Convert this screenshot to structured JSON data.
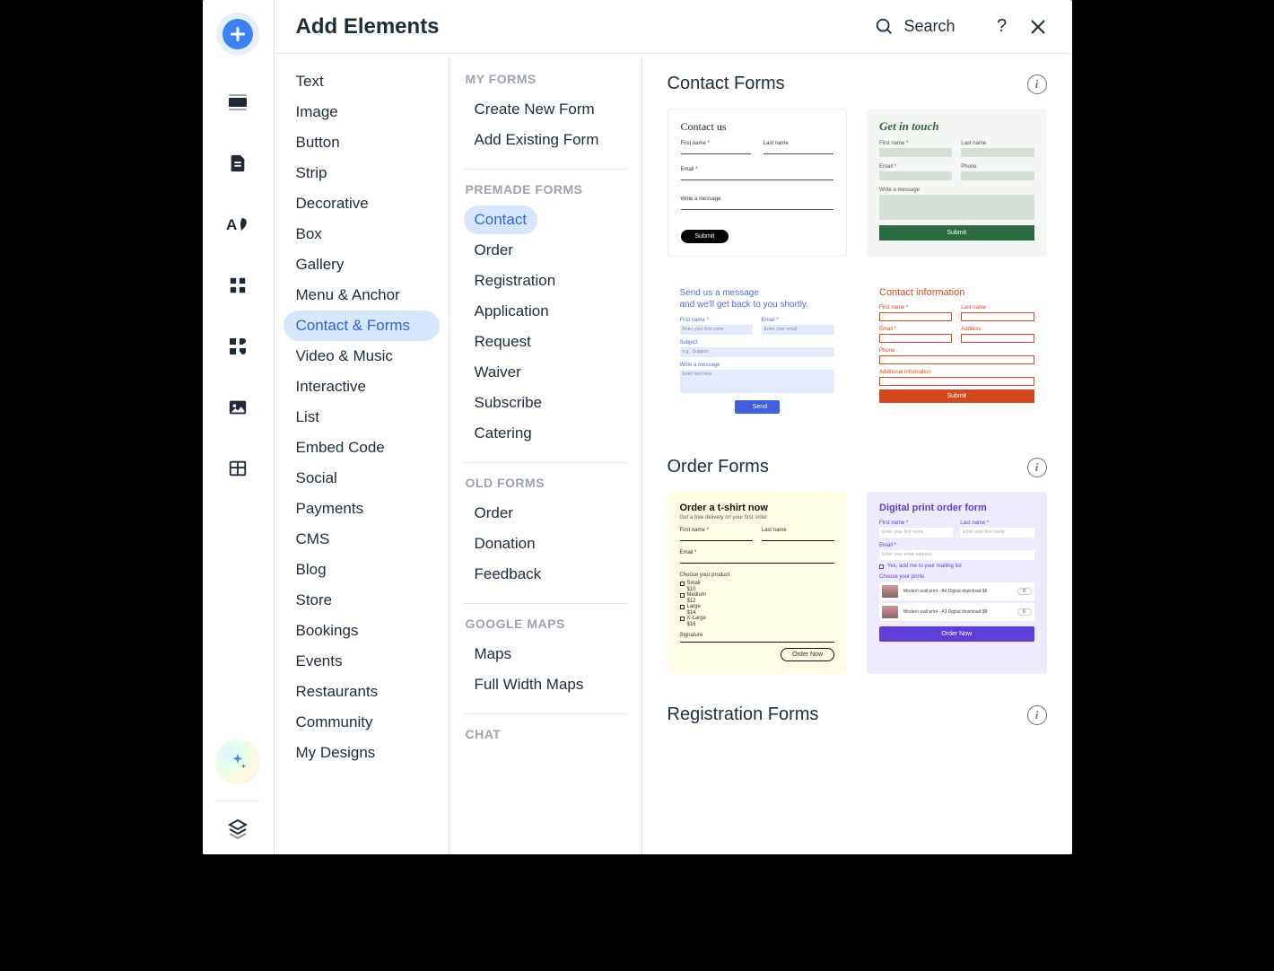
{
  "header": {
    "title": "Add Elements",
    "search_label": "Search"
  },
  "categories": [
    "Text",
    "Image",
    "Button",
    "Strip",
    "Decorative",
    "Box",
    "Gallery",
    "Menu & Anchor",
    "Contact & Forms",
    "Video & Music",
    "Interactive",
    "List",
    "Embed Code",
    "Social",
    "Payments",
    "CMS",
    "Blog",
    "Store",
    "Bookings",
    "Events",
    "Restaurants",
    "Community",
    "My Designs"
  ],
  "active_category": "Contact & Forms",
  "groups": [
    {
      "label": "MY FORMS",
      "items": [
        "Create New Form",
        "Add Existing Form"
      ]
    },
    {
      "label": "PREMADE FORMS",
      "items": [
        "Contact",
        "Order",
        "Registration",
        "Application",
        "Request",
        "Waiver",
        "Subscribe",
        "Catering"
      ]
    },
    {
      "label": "OLD FORMS",
      "items": [
        "Order",
        "Donation",
        "Feedback"
      ]
    },
    {
      "label": "GOOGLE MAPS",
      "items": [
        "Maps",
        "Full Width Maps"
      ]
    },
    {
      "label": "CHAT",
      "items": []
    }
  ],
  "active_sub": "Contact",
  "sections": [
    {
      "title": "Contact Forms"
    },
    {
      "title": "Order Forms"
    },
    {
      "title": "Registration Forms"
    }
  ],
  "previews": {
    "pv1": {
      "title": "Contact us",
      "first": "First name *",
      "last": "Last name",
      "email": "Email *",
      "msg": "Write a message",
      "btn": "Submit"
    },
    "pv2": {
      "title": "Get in touch",
      "first": "First name *",
      "last": "Last name",
      "email": "Email *",
      "phone": "Phone",
      "msg": "Write a message",
      "btn": "Submit"
    },
    "pv3": {
      "title_l1": "Send us a message",
      "title_l2": "and we'll get back to you shortly.",
      "first": "First name *",
      "email": "Email *",
      "ph_first": "Enter your first name",
      "ph_email": "Enter your email",
      "subject": "Subject",
      "ph_subject": "e.g., Support",
      "msg": "Write a message",
      "ph_msg": "Enter text here",
      "btn": "Send"
    },
    "pv4": {
      "title": "Contact information",
      "first": "First name *",
      "last": "Last name",
      "email": "Email *",
      "addr": "Address",
      "phone": "Phone",
      "addl": "Additional information",
      "btn": "Submit"
    },
    "pv5": {
      "title": "Order a t-shirt now",
      "sub": "Get a free delivery on your first order",
      "first": "First name *",
      "last": "Last name",
      "email": "Email *",
      "choose": "Choose your product",
      "opts": [
        "Small $10",
        "Medium $12",
        "Large $14",
        "X-Large $16"
      ],
      "sig": "Signature",
      "btn": "Order Now"
    },
    "pv6": {
      "title": "Digital print order form",
      "first": "First name *",
      "last": "Last name *",
      "ph_name": "Enter your first name",
      "email": "Email *",
      "ph_email": "Enter your email address",
      "chk": "Yes, add me to your mailing list",
      "choose": "Choose your prints",
      "prod1": "Modern wall print - A4 Digital download $5",
      "prod2": "Modern wall print - A3 Digital download $8",
      "qty": "0",
      "btn": "Order Now"
    }
  }
}
